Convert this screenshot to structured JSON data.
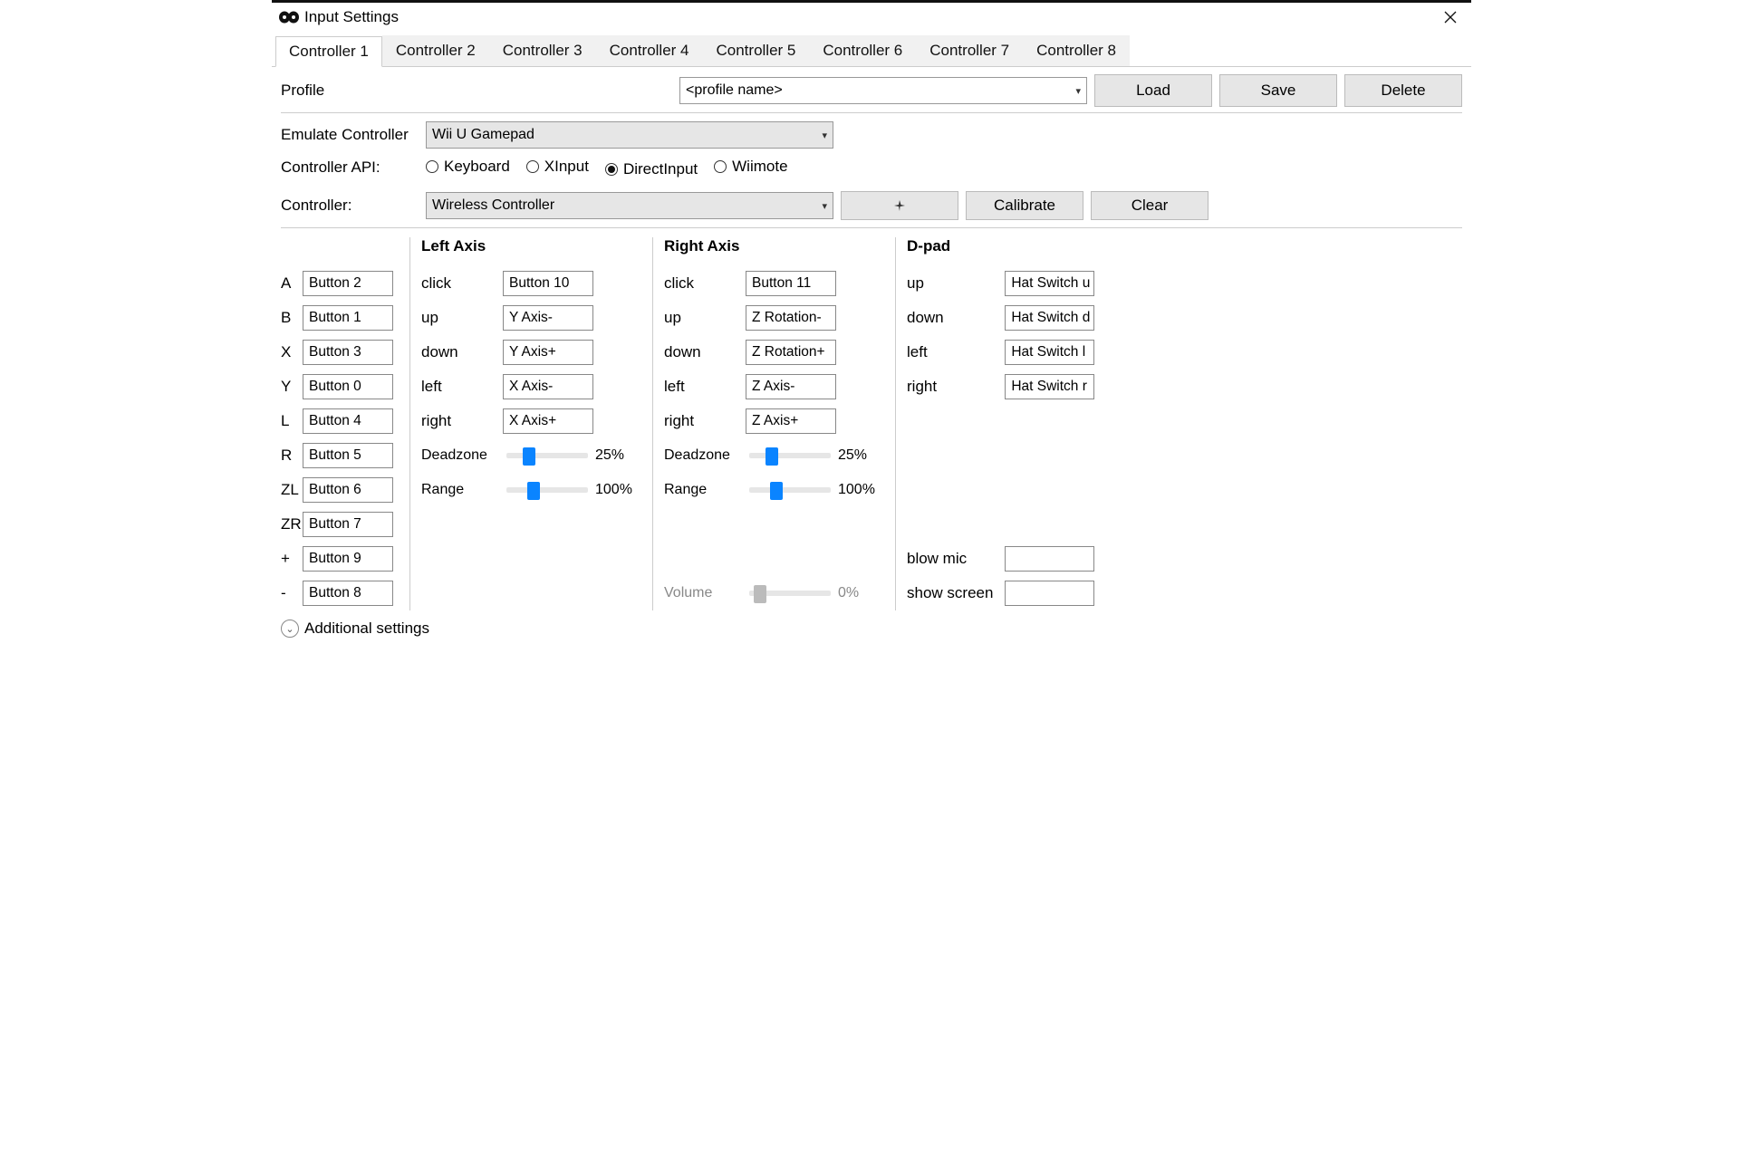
{
  "window_title": "Input Settings",
  "tabs": [
    "Controller 1",
    "Controller 2",
    "Controller 3",
    "Controller 4",
    "Controller 5",
    "Controller 6",
    "Controller 7",
    "Controller 8"
  ],
  "active_tab_index": 0,
  "profile": {
    "label": "Profile",
    "placeholder": "<profile name>",
    "load": "Load",
    "save": "Save",
    "delete": "Delete"
  },
  "emulate": {
    "label": "Emulate Controller",
    "value": "Wii U Gamepad"
  },
  "api": {
    "label": "Controller API:",
    "options": [
      "Keyboard",
      "XInput",
      "DirectInput",
      "Wiimote"
    ],
    "selected": "DirectInput"
  },
  "controller": {
    "label": "Controller:",
    "value": "Wireless Controller",
    "calibrate": "Calibrate",
    "clear": "Clear"
  },
  "buttons": [
    {
      "name": "A",
      "binding": "Button 2"
    },
    {
      "name": "B",
      "binding": "Button 1"
    },
    {
      "name": "X",
      "binding": "Button 3"
    },
    {
      "name": "Y",
      "binding": "Button 0"
    },
    {
      "name": "L",
      "binding": "Button 4"
    },
    {
      "name": "R",
      "binding": "Button 5"
    },
    {
      "name": "ZL",
      "binding": "Button 6"
    },
    {
      "name": "ZR",
      "binding": "Button 7"
    },
    {
      "name": "+",
      "binding": "Button 9"
    },
    {
      "name": "-",
      "binding": "Button 8"
    }
  ],
  "left_axis": {
    "title": "Left Axis",
    "rows": [
      {
        "label": "click",
        "binding": "Button 10"
      },
      {
        "label": "up",
        "binding": "Y Axis-"
      },
      {
        "label": "down",
        "binding": "Y Axis+"
      },
      {
        "label": "left",
        "binding": "X Axis-"
      },
      {
        "label": "right",
        "binding": "X Axis+"
      }
    ],
    "deadzone": {
      "label": "Deadzone",
      "value": "25%",
      "pct": 25
    },
    "range": {
      "label": "Range",
      "value": "100%",
      "pct": 30
    }
  },
  "right_axis": {
    "title": "Right Axis",
    "rows": [
      {
        "label": "click",
        "binding": "Button 11"
      },
      {
        "label": "up",
        "binding": "Z Rotation-"
      },
      {
        "label": "down",
        "binding": "Z Rotation+"
      },
      {
        "label": "left",
        "binding": "Z Axis-"
      },
      {
        "label": "right",
        "binding": "Z Axis+"
      }
    ],
    "deadzone": {
      "label": "Deadzone",
      "value": "25%",
      "pct": 25
    },
    "range": {
      "label": "Range",
      "value": "100%",
      "pct": 30
    },
    "volume": {
      "label": "Volume",
      "value": "0%",
      "pct": 10
    }
  },
  "dpad": {
    "title": "D-pad",
    "rows": [
      {
        "label": "up",
        "binding": "Hat Switch u"
      },
      {
        "label": "down",
        "binding": "Hat Switch d"
      },
      {
        "label": "left",
        "binding": "Hat Switch l"
      },
      {
        "label": "right",
        "binding": "Hat Switch r"
      }
    ],
    "extra": [
      {
        "label": "blow mic",
        "binding": ""
      },
      {
        "label": "show screen",
        "binding": ""
      }
    ]
  },
  "additional": "Additional settings"
}
